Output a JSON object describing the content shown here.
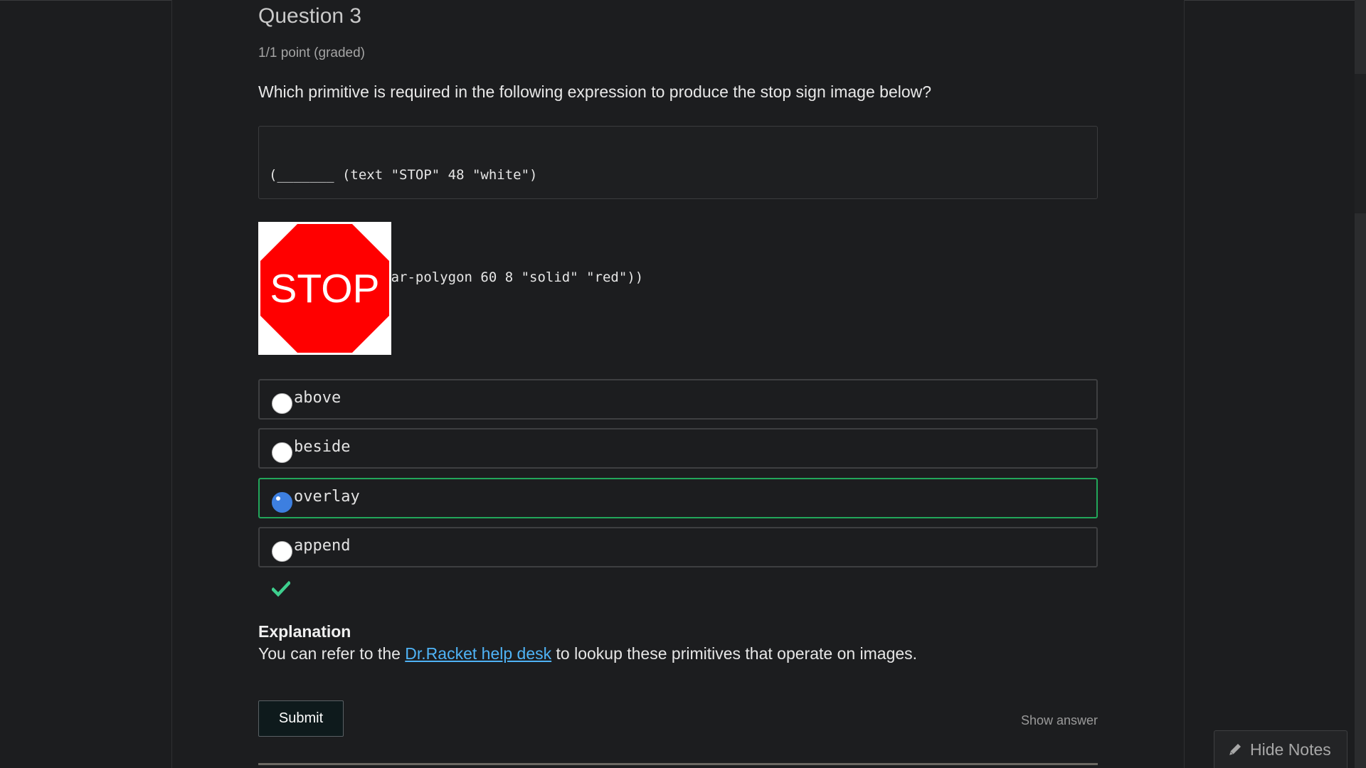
{
  "question": {
    "title": "Question 3",
    "points": "1/1 point (graded)",
    "prompt": "Which primitive is required in the following expression to produce the stop sign image below?",
    "code_lines": [
      "(_______ (text \"STOP\" 48 \"white\")",
      "         (regular-polygon 60 8 \"solid\" \"red\"))"
    ],
    "image_text": "STOP",
    "choices": [
      {
        "label": "above",
        "selected": false
      },
      {
        "label": "beside",
        "selected": false
      },
      {
        "label": "overlay",
        "selected": true
      },
      {
        "label": "append",
        "selected": false
      }
    ],
    "result_icon": "check-icon"
  },
  "explanation": {
    "heading": "Explanation",
    "text_before": "You can refer to the ",
    "link_text": "Dr.Racket help desk",
    "text_after": " to lookup these primitives that operate on images."
  },
  "actions": {
    "submit_label": "Submit",
    "show_answer_label": "Show answer"
  },
  "notes": {
    "hide_label": "Hide Notes",
    "icon": "pencil-icon"
  },
  "colors": {
    "background": "#1c1d1f",
    "correct_border": "#22a65a",
    "check": "#3ecf8e",
    "link": "#4fb3f6",
    "radio_selected": "#3d7fe0",
    "stop_red": "#ff0000"
  }
}
